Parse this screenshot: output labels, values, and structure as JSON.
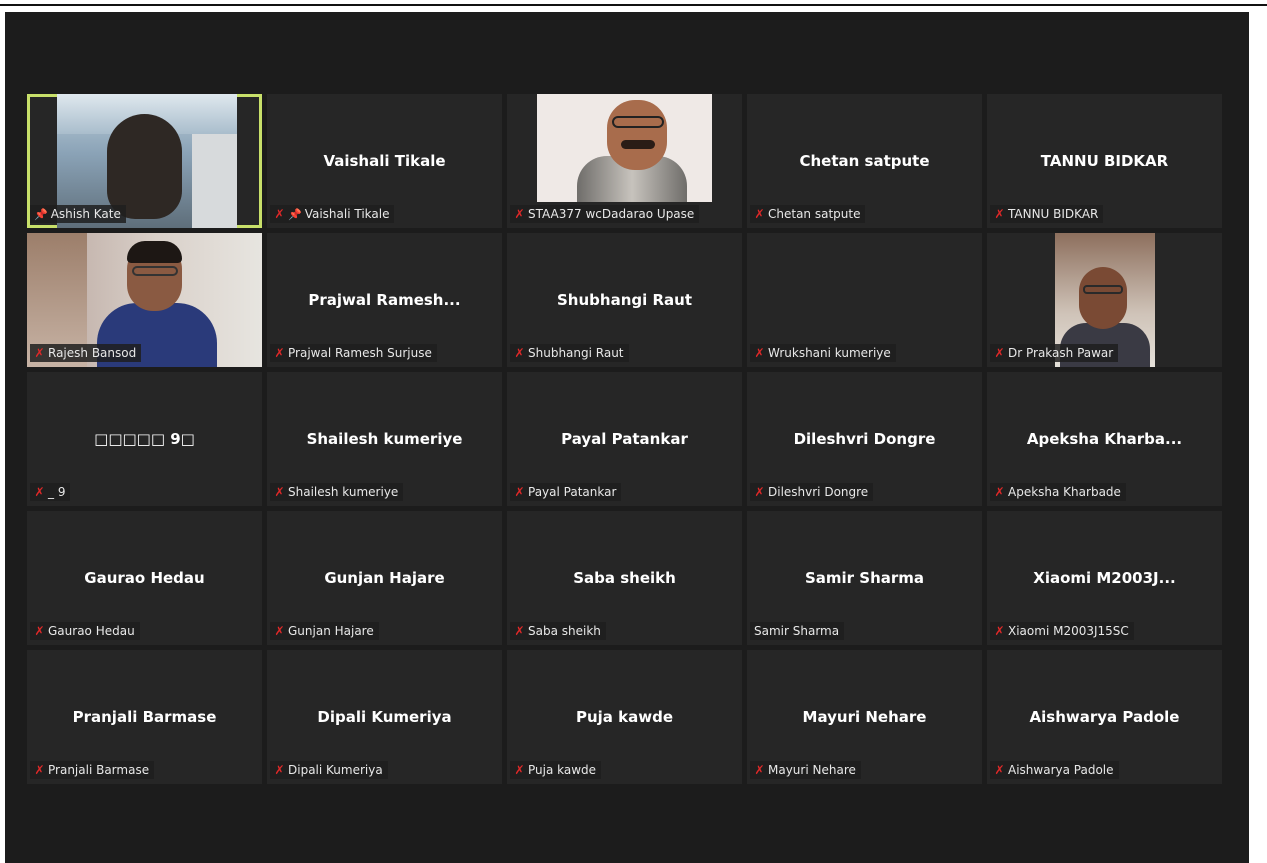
{
  "participants": [
    {
      "name": "",
      "tag": "Ashish Kate",
      "pinned": true,
      "muted": false,
      "video": true
    },
    {
      "name": "Vaishali Tikale",
      "tag": "Vaishali Tikale",
      "pinned": true,
      "muted": true,
      "video": false
    },
    {
      "name": "",
      "tag": "STAA377 wcDadarao Upase",
      "pinned": false,
      "muted": true,
      "video": true
    },
    {
      "name": "Chetan satpute",
      "tag": "Chetan satpute",
      "pinned": false,
      "muted": true,
      "video": false
    },
    {
      "name": "TANNU BIDKAR",
      "tag": "TANNU BIDKAR",
      "pinned": false,
      "muted": true,
      "video": false
    },
    {
      "name": "",
      "tag": "Rajesh Bansod",
      "pinned": false,
      "muted": true,
      "video": true
    },
    {
      "name": "Prajwal  Ramesh...",
      "tag": "Prajwal Ramesh Surjuse",
      "pinned": false,
      "muted": true,
      "video": false
    },
    {
      "name": "Shubhangi Raut",
      "tag": "Shubhangi Raut",
      "pinned": false,
      "muted": true,
      "video": false
    },
    {
      "name": "",
      "tag": "Wrukshani kumeriye",
      "pinned": false,
      "muted": true,
      "video": false
    },
    {
      "name": "",
      "tag": "Dr Prakash Pawar",
      "pinned": false,
      "muted": true,
      "video": true
    },
    {
      "name": "□□□□□ 9□",
      "tag": "_ 9",
      "pinned": false,
      "muted": true,
      "video": false
    },
    {
      "name": "Shailesh kumeriye",
      "tag": "Shailesh kumeriye",
      "pinned": false,
      "muted": true,
      "video": false
    },
    {
      "name": "Payal Patankar",
      "tag": "Payal Patankar",
      "pinned": false,
      "muted": true,
      "video": false
    },
    {
      "name": "Dileshvri Dongre",
      "tag": "Dileshvri Dongre",
      "pinned": false,
      "muted": true,
      "video": false
    },
    {
      "name": "Apeksha  Kharba...",
      "tag": "Apeksha Kharbade",
      "pinned": false,
      "muted": true,
      "video": false
    },
    {
      "name": "Gaurao Hedau",
      "tag": "Gaurao Hedau",
      "pinned": false,
      "muted": true,
      "video": false
    },
    {
      "name": "Gunjan Hajare",
      "tag": "Gunjan Hajare",
      "pinned": false,
      "muted": true,
      "video": false
    },
    {
      "name": "Saba sheikh",
      "tag": "Saba sheikh",
      "pinned": false,
      "muted": true,
      "video": false
    },
    {
      "name": "Samir Sharma",
      "tag": "Samir Sharma",
      "pinned": false,
      "muted": false,
      "video": false
    },
    {
      "name": "Xiaomi  M2003J...",
      "tag": "Xiaomi M2003J15SC",
      "pinned": false,
      "muted": true,
      "video": false
    },
    {
      "name": "Pranjali  Barmase",
      "tag": "Pranjali  Barmase",
      "pinned": false,
      "muted": true,
      "video": false
    },
    {
      "name": "Dipali Kumeriya",
      "tag": "Dipali Kumeriya",
      "pinned": false,
      "muted": true,
      "video": false
    },
    {
      "name": "Puja kawde",
      "tag": "Puja kawde",
      "pinned": false,
      "muted": true,
      "video": false
    },
    {
      "name": "Mayuri Nehare",
      "tag": "Mayuri Nehare",
      "pinned": false,
      "muted": true,
      "video": false
    },
    {
      "name": "Aishwarya Padole",
      "tag": "Aishwarya Padole",
      "pinned": false,
      "muted": true,
      "video": false
    }
  ],
  "active_speaker_color": "#c8e06a",
  "muted_icon_color": "#e02828",
  "icons": {
    "muted": "mic-muted-icon",
    "pinned": "pin-icon"
  }
}
